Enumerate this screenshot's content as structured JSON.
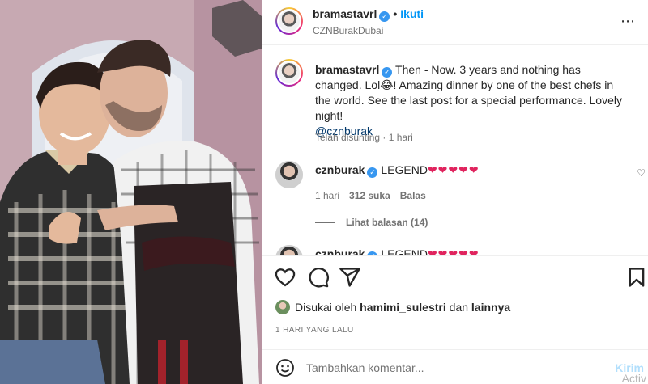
{
  "header": {
    "username": "bramastavrl",
    "follow_label": "Ikuti",
    "location": "CZNBurakDubai",
    "more_icon": "⋯"
  },
  "caption": {
    "username": "bramastavrl",
    "text_before_emoji": "Then - Now. 3 years and nothing has changed. Lol",
    "emoji": "😂",
    "text_after_emoji": "! Amazing dinner by one of the best chefs in the world. See the last post for a special performance. Lovely night!",
    "mention": "@cznburak",
    "edited": "Telah disunting",
    "edited_time": "1 hari"
  },
  "comments": [
    {
      "username": "cznburak",
      "text": "LEGEND",
      "hearts": "❤❤❤❤❤",
      "time": "1 hari",
      "likes": "312 suka",
      "reply_label": "Balas",
      "view_replies": "Lihat balasan (14)"
    },
    {
      "username": "cznburak",
      "text": "LEGEND",
      "hearts": "❤❤❤❤❤"
    }
  ],
  "likes": {
    "prefix": "Disukai oleh",
    "user": "hamimi_sulestri",
    "connector": "dan",
    "others": "lainnya"
  },
  "time_ago": "1 HARI YANG LALU",
  "add_comment": {
    "placeholder": "Tambahkan komentar...",
    "post_label": "Kirim"
  },
  "watermark": "Activ",
  "colors": {
    "accent": "#0095f6",
    "verified": "#3797f0",
    "heart": "#e0245e"
  }
}
